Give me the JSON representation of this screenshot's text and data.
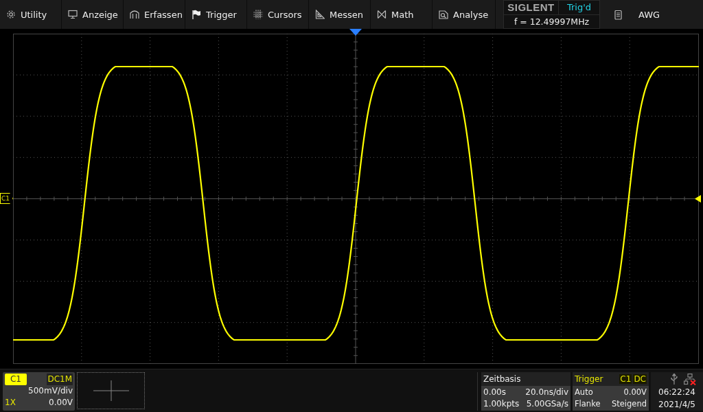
{
  "menu": [
    {
      "label": "Utility"
    },
    {
      "label": "Anzeige"
    },
    {
      "label": "Erfassen"
    },
    {
      "label": "Trigger"
    },
    {
      "label": "Cursors"
    },
    {
      "label": "Messen"
    },
    {
      "label": "Math"
    },
    {
      "label": "Analyse"
    }
  ],
  "header": {
    "brand": "SIGLENT",
    "trigger_status": "Trig'd",
    "frequency": "f = 12.49997MHz"
  },
  "awg": {
    "label": "AWG"
  },
  "plot": {
    "channel_marker": "C1"
  },
  "channel": {
    "label": "C1",
    "coupling": "DC1M",
    "scale": "500mV/div",
    "probe": "1X",
    "offset": "0.00V"
  },
  "timebase": {
    "title": "Zeitbasis",
    "delay": "0.00s",
    "scale": "20.0ns/div",
    "memory": "1.00kpts",
    "sample_rate": "5.00GSa/s"
  },
  "trigger": {
    "title": "Trigger",
    "source": "C1",
    "coupling": "DC",
    "mode": "Auto",
    "level": "0.00V",
    "type": "Flanke",
    "slope": "Steigend"
  },
  "clock": {
    "time": "06:22:24",
    "date": "2021/4/5"
  }
}
